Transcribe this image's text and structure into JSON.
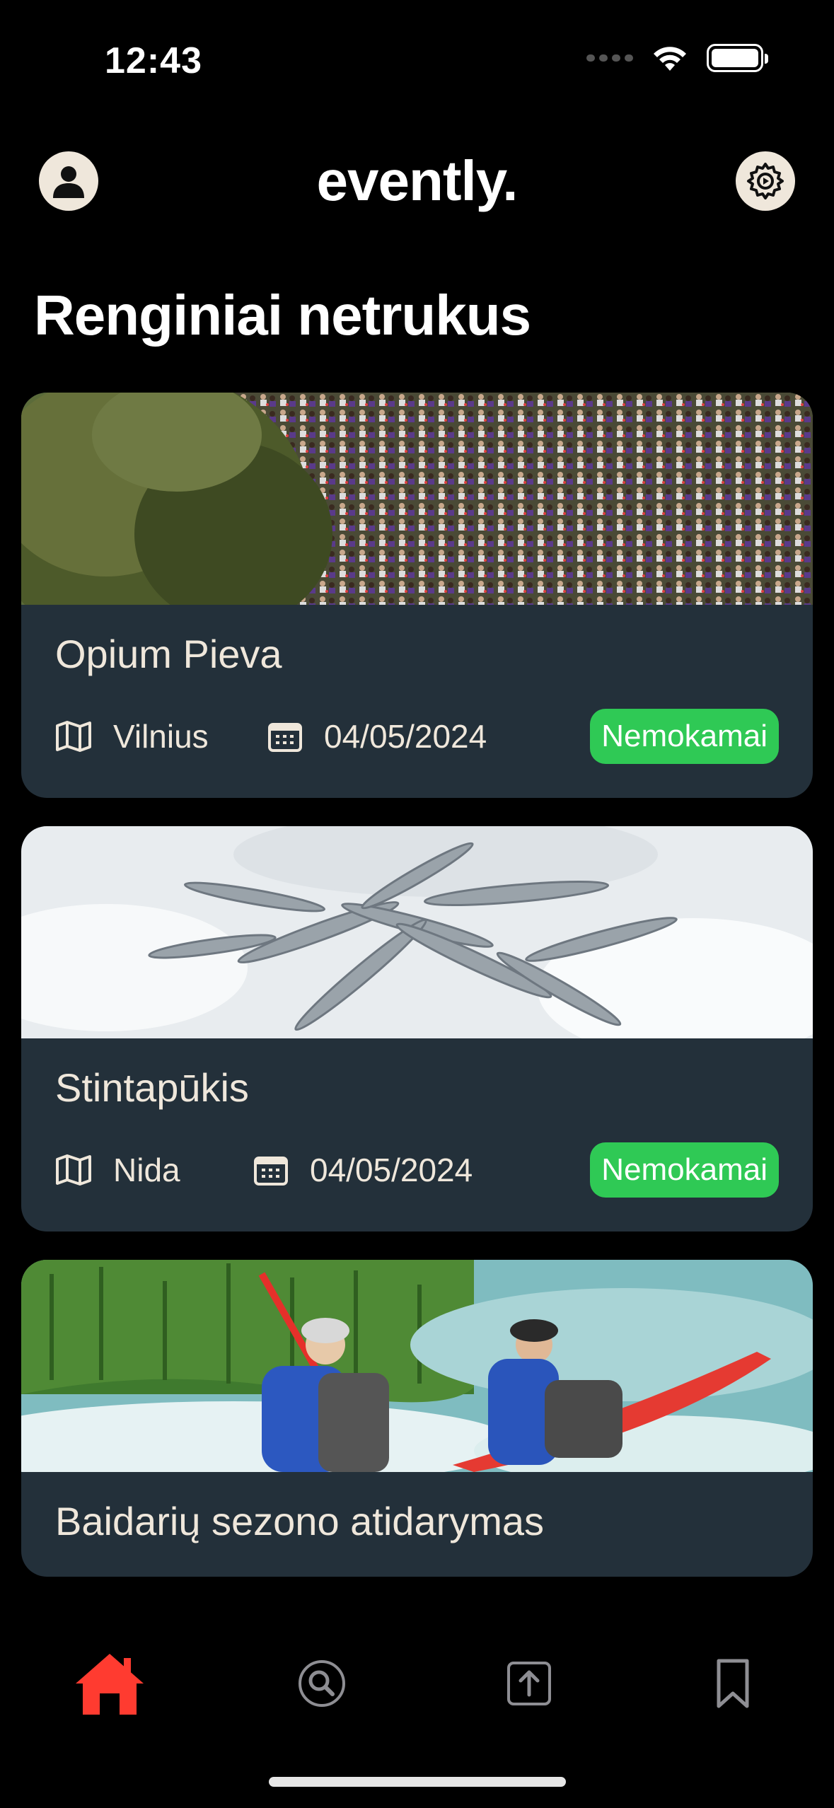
{
  "status_bar": {
    "time": "12:43"
  },
  "header": {
    "brand": "evently.",
    "profile_icon": "profile-icon",
    "settings_icon": "settings-icon"
  },
  "section": {
    "title": "Renginiai netrukus"
  },
  "events": [
    {
      "title": "Opium Pieva",
      "location": "Vilnius",
      "date": "04/05/2024",
      "price": "Nemokamai",
      "image": "crowd-on-grass-photo"
    },
    {
      "title": "Stintapūkis",
      "location": "Nida",
      "date": "04/05/2024",
      "price": "Nemokamai",
      "image": "smelt-fish-on-snow-photo"
    },
    {
      "title": "Baidarių sezono atidarymas",
      "location": "",
      "date": "",
      "price": "",
      "image": "kayakers-on-river-photo"
    }
  ],
  "tabbar": {
    "items": [
      {
        "name": "home",
        "icon": "home-icon",
        "active": true
      },
      {
        "name": "search",
        "icon": "search-icon",
        "active": false
      },
      {
        "name": "upload",
        "icon": "upload-icon",
        "active": false
      },
      {
        "name": "saved",
        "icon": "bookmark-icon",
        "active": false
      }
    ]
  },
  "colors": {
    "accent": "#ff3b30",
    "badge": "#2fc955",
    "card": "#23303a",
    "text_light": "#efe7db"
  }
}
